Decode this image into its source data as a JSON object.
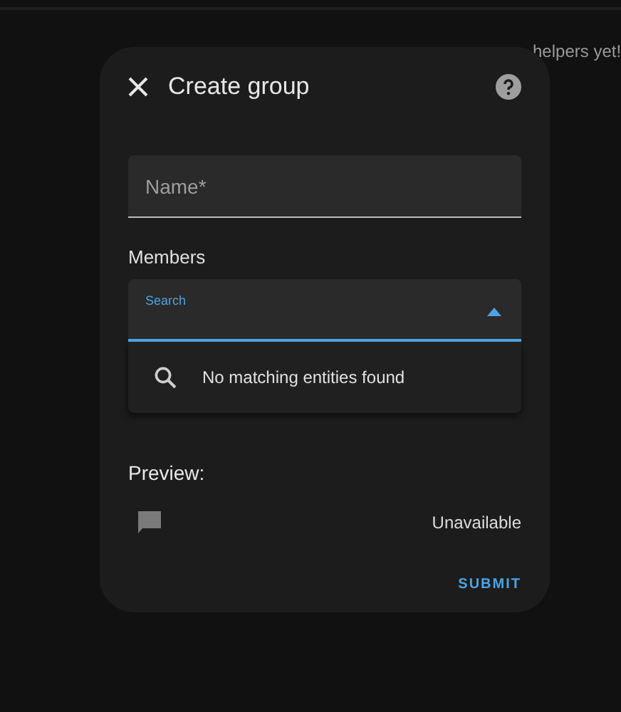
{
  "background": {
    "message": "helpers yet!"
  },
  "dialog": {
    "title": "Create group",
    "name_field": {
      "placeholder": "Name*"
    },
    "members_label": "Members",
    "search_field": {
      "label": "Search",
      "expanded": true
    },
    "dropdown": {
      "empty_message": "No matching entities found"
    },
    "preview_label": "Preview:",
    "preview_state": "Unavailable",
    "submit": "SUBMIT"
  }
}
